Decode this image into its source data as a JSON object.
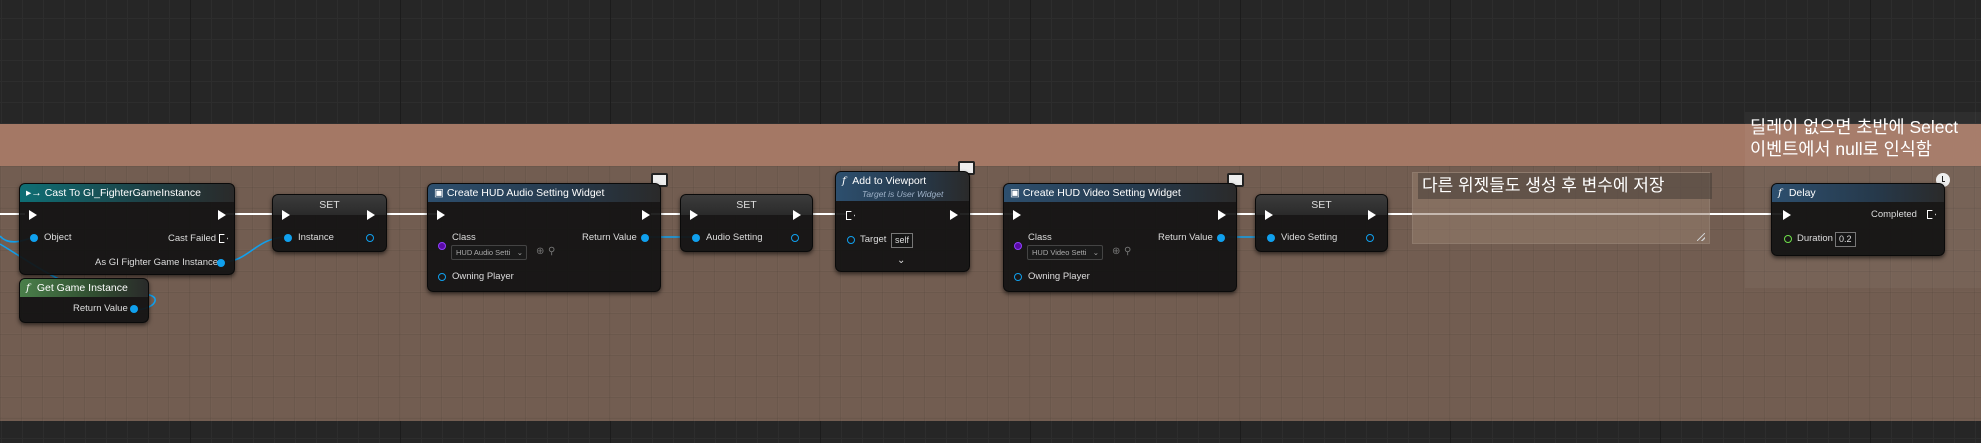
{
  "comment_header_title": [
    "딜레이 없으면  초반에 Select",
    "이벤트에서 null로 인식함"
  ],
  "comment_note": "다른 위젯들도 생성 후 변수에 저장",
  "nodes": {
    "cast": {
      "title": "Cast To GI_FighterGameInstance",
      "pin_object": "Object",
      "pin_cast_failed": "Cast Failed",
      "pin_as": "As GI Fighter Game Instance"
    },
    "get_game_instance": {
      "title": "Get Game Instance",
      "pin_return": "Return Value"
    },
    "set_instance": {
      "title": "SET",
      "pin": "Instance"
    },
    "create_audio": {
      "title": "Create HUD Audio Setting Widget",
      "pin_class": "Class",
      "class_value": "HUD Audio Setti",
      "pin_return": "Return Value",
      "pin_owning": "Owning Player"
    },
    "set_audio": {
      "title": "SET",
      "pin": "Audio Setting"
    },
    "add_viewport": {
      "title": "Add to Viewport",
      "subtitle": "Target is User Widget",
      "pin_target": "Target",
      "target_value": "self"
    },
    "create_video": {
      "title": "Create HUD Video Setting Widget",
      "pin_class": "Class",
      "class_value": "HUD Video Setti",
      "pin_return": "Return Value",
      "pin_owning": "Owning Player"
    },
    "set_video": {
      "title": "SET",
      "pin": "Video Setting"
    },
    "delay": {
      "title": "Delay",
      "pin_completed": "Completed",
      "pin_duration": "Duration",
      "duration_value": "0.2"
    }
  },
  "colors": {
    "exec": "#ffffff",
    "object_pin": "#10a0ee",
    "class_pin": "#5a0aa6",
    "float_pin": "#6ee04a",
    "comment_header": "#a47865",
    "comment_body": "#846a5c"
  },
  "icons": [
    "cast-icon",
    "function-icon",
    "monitor-icon",
    "clock-icon",
    "chevron-down-icon",
    "resize-icon"
  ]
}
